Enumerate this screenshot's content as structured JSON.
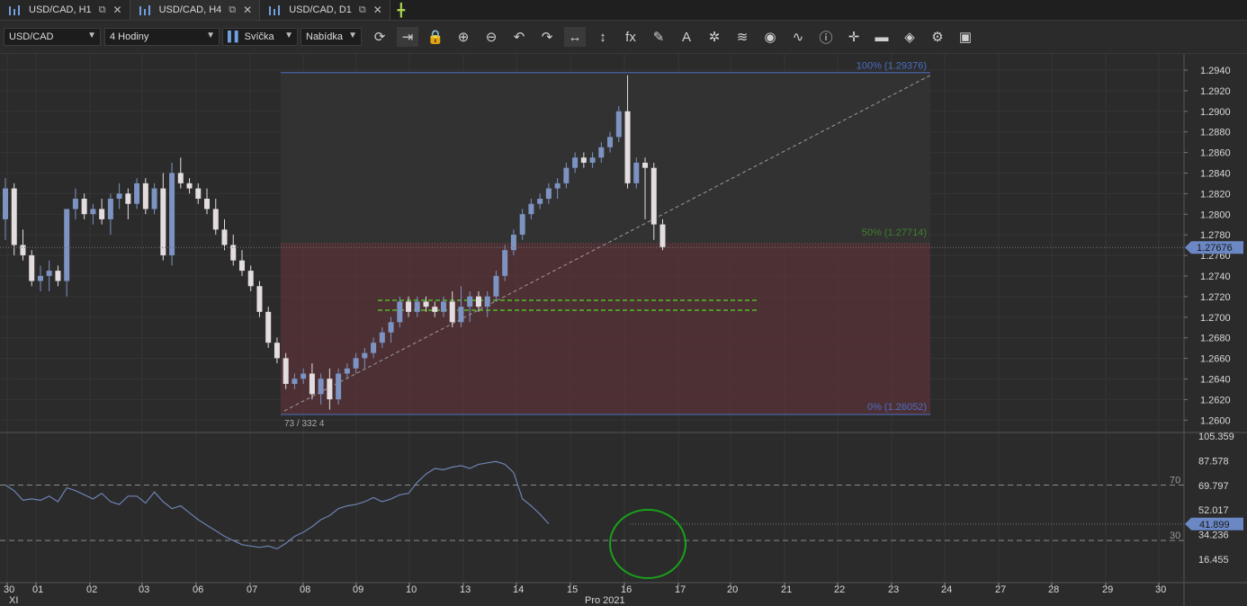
{
  "tabs": [
    {
      "label": "USD/CAD, H1",
      "active": false
    },
    {
      "label": "USD/CAD, H4",
      "active": true
    },
    {
      "label": "USD/CAD, D1",
      "active": false
    }
  ],
  "toolbar": {
    "symbol": "USD/CAD",
    "timeframe": "4 Hodiny",
    "chart_type": "Svíčka",
    "price_side": "Nabídka",
    "icons": [
      "refresh-icon",
      "auto-scroll-icon",
      "lock-icon",
      "zoom-in-icon",
      "zoom-out-icon",
      "undo-icon",
      "redo-icon",
      "horizontal-line-icon",
      "vertical-line-icon",
      "indicators-fx-icon",
      "pencil-icon",
      "text-icon",
      "pattern-icon",
      "layers-icon",
      "eye-icon",
      "alerts-icon",
      "info-icon",
      "crosshair-icon",
      "ruler-icon",
      "fill-icon",
      "settings-icon",
      "save-icon"
    ]
  },
  "colors": {
    "bull": "#7d93c2",
    "bear": "#e3dde0",
    "fibZone": "#5a3338",
    "fib100": "#4a6fc4",
    "fib0": "#4a6fc4",
    "fib50": "#3e7f2e",
    "rsiLine": "#6e82b3",
    "priceBox": "#6b88c4",
    "circle": "#19a21c"
  },
  "price_axis": {
    "labels": [
      "1.2940",
      "1.2920",
      "1.2900",
      "1.2880",
      "1.2860",
      "1.2840",
      "1.2820",
      "1.2800",
      "1.2780",
      "1.2760",
      "1.2740",
      "1.2720",
      "1.2700",
      "1.2680",
      "1.2660",
      "1.2640",
      "1.2620",
      "1.2600"
    ],
    "current": "1.27676"
  },
  "fib": {
    "top_label": "100% (1.29376)",
    "bottom_label": "0% (1.26052)",
    "mid_label": "50% (1.27714)",
    "counter": "73 / 332 4"
  },
  "rsi": {
    "axis_labels": [
      "105.359",
      "87.578",
      "69.797",
      "52.017",
      "34.236",
      "16.455"
    ],
    "current": "41.899",
    "level_high": "70",
    "level_low": "30",
    "values": [
      70,
      66,
      59,
      60,
      59,
      62,
      58,
      68,
      66,
      63,
      60,
      64,
      58,
      56,
      62,
      62,
      57,
      65,
      58,
      53,
      55,
      50,
      45,
      41,
      37,
      33,
      30,
      27,
      26,
      25,
      26,
      24,
      28,
      33,
      36,
      40,
      45,
      48,
      53,
      55,
      56,
      58,
      61,
      58,
      60,
      63,
      64,
      72,
      78,
      82,
      81,
      83,
      84,
      82,
      85,
      86,
      87,
      85,
      79,
      60,
      55,
      49,
      42
    ]
  },
  "chart_data": {
    "type": "candlestick",
    "symbol": "USD/CAD",
    "timeframe": "4 Hodiny",
    "ylim": [
      1.26,
      1.295
    ],
    "candles": [
      [
        1.2795,
        1.2835,
        1.2775,
        1.2825
      ],
      [
        1.2825,
        1.283,
        1.276,
        1.277
      ],
      [
        1.277,
        1.2785,
        1.2755,
        1.276
      ],
      [
        1.276,
        1.2765,
        1.273,
        1.2735
      ],
      [
        1.2735,
        1.275,
        1.2725,
        1.274
      ],
      [
        1.274,
        1.2755,
        1.2725,
        1.2745
      ],
      [
        1.2745,
        1.275,
        1.273,
        1.2735
      ],
      [
        1.2735,
        1.2805,
        1.272,
        1.2805
      ],
      [
        1.2805,
        1.2825,
        1.2795,
        1.2815
      ],
      [
        1.2815,
        1.282,
        1.2795,
        1.28
      ],
      [
        1.28,
        1.281,
        1.279,
        1.2805
      ],
      [
        1.2805,
        1.2815,
        1.279,
        1.2795
      ],
      [
        1.2795,
        1.282,
        1.278,
        1.2815
      ],
      [
        1.2815,
        1.283,
        1.2805,
        1.282
      ],
      [
        1.282,
        1.2825,
        1.2795,
        1.281
      ],
      [
        1.281,
        1.2835,
        1.2805,
        1.283
      ],
      [
        1.283,
        1.2835,
        1.28,
        1.2805
      ],
      [
        1.2805,
        1.283,
        1.28,
        1.2825
      ],
      [
        1.2825,
        1.284,
        1.2755,
        1.276
      ],
      [
        1.276,
        1.285,
        1.275,
        1.284
      ],
      [
        1.284,
        1.2855,
        1.2825,
        1.283
      ],
      [
        1.283,
        1.2835,
        1.282,
        1.2825
      ],
      [
        1.2825,
        1.283,
        1.281,
        1.2815
      ],
      [
        1.2815,
        1.2825,
        1.28,
        1.2805
      ],
      [
        1.2805,
        1.2815,
        1.278,
        1.2785
      ],
      [
        1.2785,
        1.2795,
        1.2765,
        1.277
      ],
      [
        1.277,
        1.278,
        1.275,
        1.2755
      ],
      [
        1.2755,
        1.2765,
        1.274,
        1.2745
      ],
      [
        1.2745,
        1.275,
        1.2725,
        1.273
      ],
      [
        1.273,
        1.2735,
        1.27,
        1.2705
      ],
      [
        1.2705,
        1.271,
        1.267,
        1.2675
      ],
      [
        1.2675,
        1.268,
        1.2655,
        1.266
      ],
      [
        1.266,
        1.2665,
        1.263,
        1.2635
      ],
      [
        1.2635,
        1.2645,
        1.263,
        1.264
      ],
      [
        1.264,
        1.265,
        1.2635,
        1.2645
      ],
      [
        1.2645,
        1.2655,
        1.262,
        1.2625
      ],
      [
        1.2625,
        1.2645,
        1.2615,
        1.264
      ],
      [
        1.264,
        1.265,
        1.261,
        1.262
      ],
      [
        1.262,
        1.265,
        1.2615,
        1.2645
      ],
      [
        1.2645,
        1.2655,
        1.264,
        1.265
      ],
      [
        1.265,
        1.2665,
        1.2645,
        1.266
      ],
      [
        1.266,
        1.267,
        1.265,
        1.2665
      ],
      [
        1.2665,
        1.268,
        1.266,
        1.2675
      ],
      [
        1.2675,
        1.269,
        1.267,
        1.2685
      ],
      [
        1.2685,
        1.27,
        1.2675,
        1.2695
      ],
      [
        1.2695,
        1.272,
        1.269,
        1.2715
      ],
      [
        1.2715,
        1.272,
        1.27,
        1.2705
      ],
      [
        1.2705,
        1.272,
        1.27,
        1.2715
      ],
      [
        1.2715,
        1.272,
        1.2705,
        1.271
      ],
      [
        1.271,
        1.2715,
        1.27,
        1.2705
      ],
      [
        1.2705,
        1.272,
        1.27,
        1.2715
      ],
      [
        1.2715,
        1.2725,
        1.269,
        1.2695
      ],
      [
        1.2695,
        1.273,
        1.269,
        1.271
      ],
      [
        1.271,
        1.2725,
        1.2695,
        1.272
      ],
      [
        1.272,
        1.2725,
        1.2705,
        1.271
      ],
      [
        1.271,
        1.2725,
        1.27,
        1.272
      ],
      [
        1.272,
        1.2745,
        1.2715,
        1.274
      ],
      [
        1.274,
        1.277,
        1.2735,
        1.2765
      ],
      [
        1.2765,
        1.2785,
        1.276,
        1.278
      ],
      [
        1.278,
        1.2805,
        1.2775,
        1.28
      ],
      [
        1.28,
        1.2815,
        1.2795,
        1.281
      ],
      [
        1.281,
        1.282,
        1.2805,
        1.2815
      ],
      [
        1.2815,
        1.283,
        1.281,
        1.2825
      ],
      [
        1.2825,
        1.2835,
        1.2815,
        1.283
      ],
      [
        1.283,
        1.285,
        1.2825,
        1.2845
      ],
      [
        1.2845,
        1.286,
        1.284,
        1.2855
      ],
      [
        1.2855,
        1.286,
        1.2845,
        1.285
      ],
      [
        1.285,
        1.286,
        1.2845,
        1.2855
      ],
      [
        1.2855,
        1.287,
        1.285,
        1.2865
      ],
      [
        1.2865,
        1.288,
        1.286,
        1.2875
      ],
      [
        1.2875,
        1.2905,
        1.287,
        1.29
      ],
      [
        1.29,
        1.2935,
        1.2825,
        1.283
      ],
      [
        1.283,
        1.2855,
        1.2825,
        1.285
      ],
      [
        1.285,
        1.2855,
        1.2795,
        1.2845
      ],
      [
        1.2845,
        1.285,
        1.2775,
        1.279
      ],
      [
        1.279,
        1.2795,
        1.2765,
        1.2768
      ]
    ],
    "x_labels": [
      "30",
      "01",
      "02",
      "03",
      "06",
      "07",
      "08",
      "09",
      "10",
      "13",
      "14",
      "15",
      "16",
      "17",
      "20",
      "21",
      "22",
      "23",
      "24",
      "27",
      "28",
      "29",
      "30"
    ],
    "x_sublabels": {
      "left": "XI",
      "center": "Pro 2021"
    }
  }
}
